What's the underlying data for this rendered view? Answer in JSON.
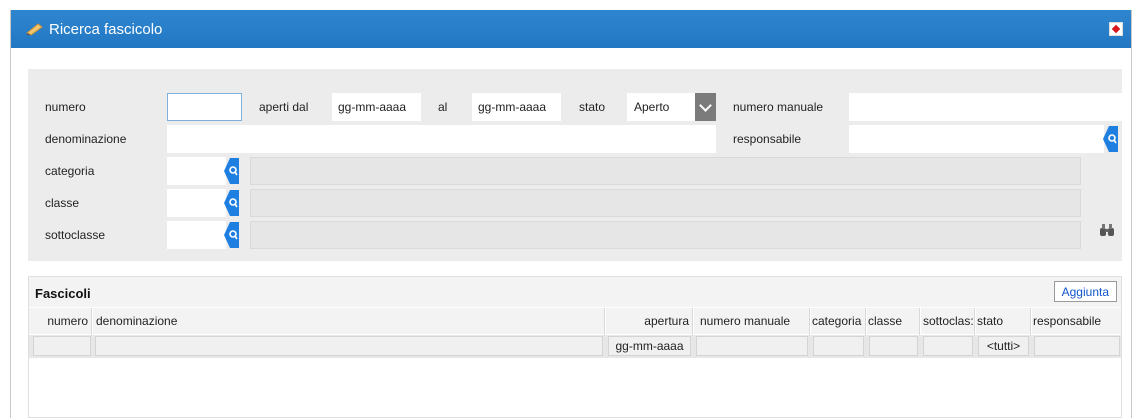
{
  "window": {
    "title": "Ricerca fascicolo",
    "icon": "pencil-icon",
    "close_icon": "close-icon"
  },
  "filters": {
    "numero_label": "numero",
    "numero_value": "",
    "aperti_dal_label": "aperti dal",
    "aperti_dal_value": "gg-mm-aaaa",
    "al_label": "al",
    "al_value": "gg-mm-aaaa",
    "stato_label": "stato",
    "stato_value": "Aperto",
    "numero_manuale_label": "numero manuale",
    "denominazione_label": "denominazione",
    "responsabile_label": "responsabile",
    "categoria_label": "categoria",
    "classe_label": "classe",
    "sottoclasse_label": "sottoclasse",
    "search_icon": "search-icon",
    "binoculars_icon": "binoculars-icon"
  },
  "grid": {
    "title": "Fascicoli",
    "add_button": "Aggiunta",
    "columns": [
      "numero",
      "denominazione",
      "apertura",
      "numero manuale",
      "categoria",
      "classe",
      "sottoclas:",
      "stato",
      "responsabile"
    ],
    "filter_apertura": "gg-mm-aaaa",
    "filter_stato": "<tutti>"
  },
  "colors": {
    "titlebar": "#2277c3",
    "accent_blue": "#1f7fe0",
    "panel": "#ececec"
  }
}
